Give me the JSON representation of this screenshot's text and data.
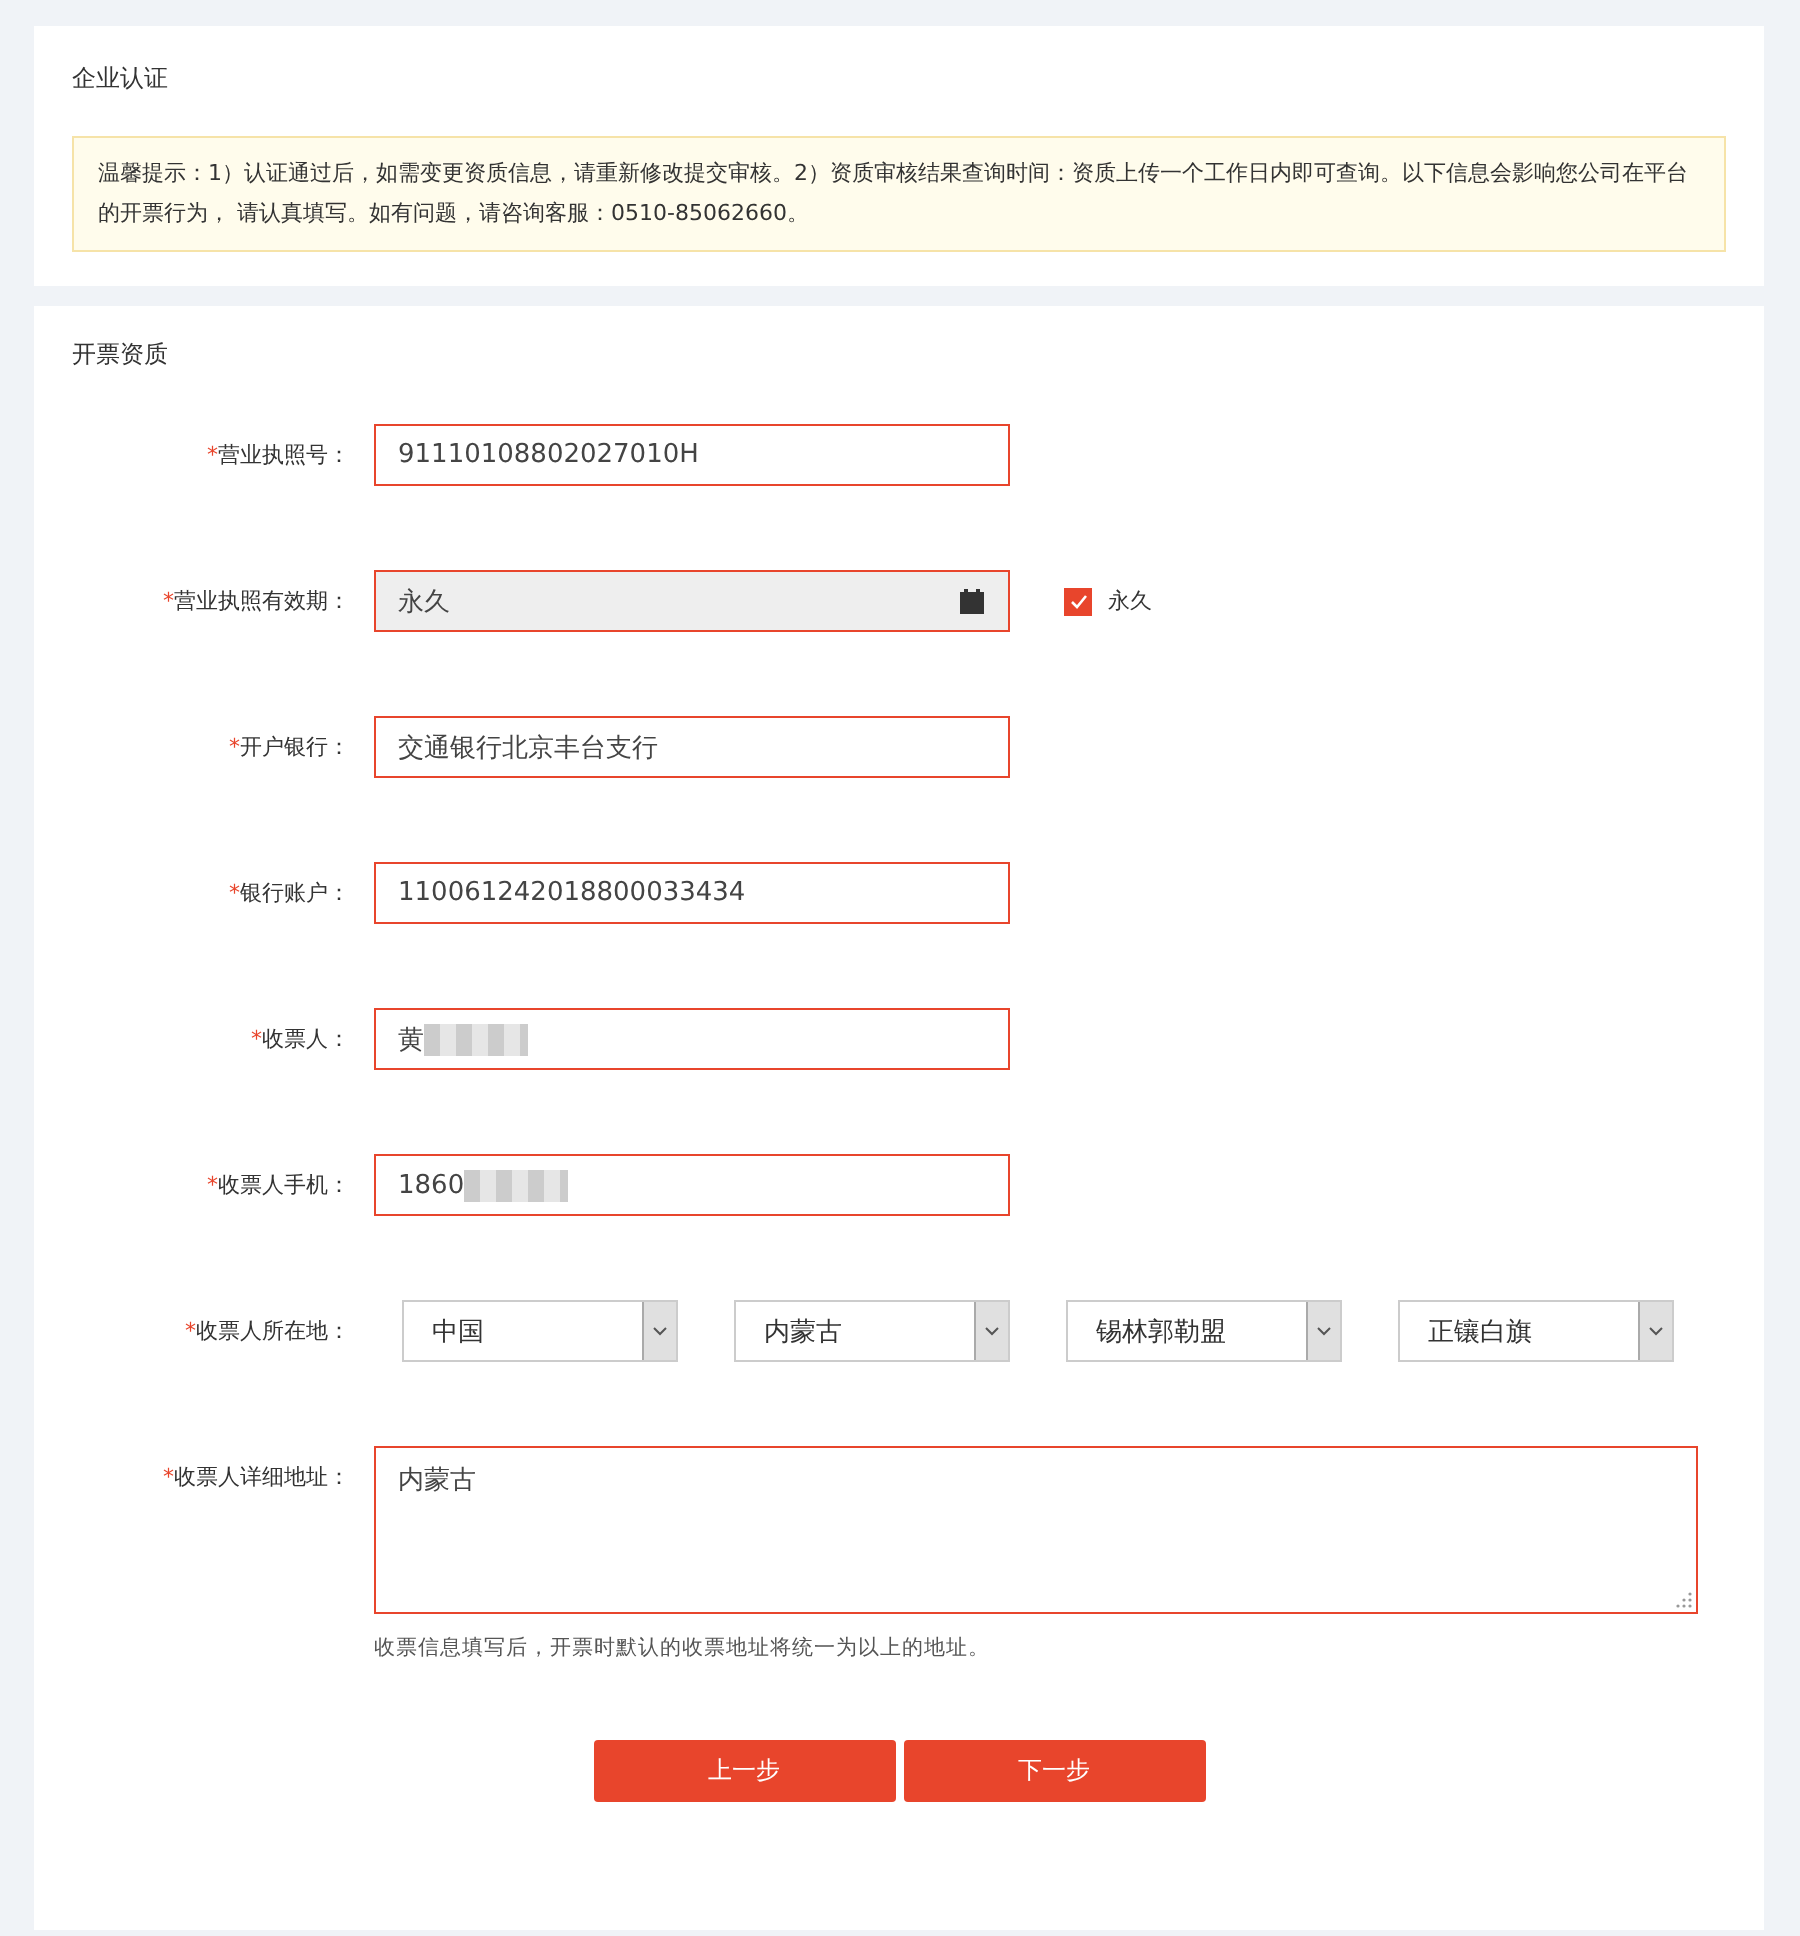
{
  "header": {
    "title": "企业认证",
    "notice": "温馨提示：1）认证通过后，如需变更资质信息，请重新修改提交审核。2）资质审核结果查询时间：资质上传一个工作日内即可查询。以下信息会影响您公司在平台的开票行为， 请认真填写。如有问题，请咨询客服：0510-85062660。"
  },
  "section": {
    "title": "开票资质"
  },
  "fields": [
    {
      "kind": "text",
      "mark": "*",
      "label": "营业执照号：",
      "value": "91110108802027010H",
      "redacted": false
    },
    {
      "kind": "date",
      "mark": "*",
      "label": "营业执照有效期：",
      "value": "永久",
      "disabled": true,
      "checkbox": {
        "label": "永久",
        "checked": true
      }
    },
    {
      "kind": "text",
      "mark": "*",
      "label": "开户银行：",
      "value": "交通银行北京丰台支行",
      "redacted": false
    },
    {
      "kind": "text",
      "mark": "*",
      "label": "银行账户：",
      "value": "110061242018800033434",
      "redacted": false
    },
    {
      "kind": "text",
      "mark": "*",
      "label": "收票人：",
      "value": "黄",
      "redacted": true
    },
    {
      "kind": "text",
      "mark": "*",
      "label": "收票人手机：",
      "value": "1860",
      "redacted": true
    },
    {
      "kind": "select",
      "mark": "*",
      "label": "收票人所在地：",
      "options": [
        {
          "value": "中国"
        },
        {
          "value": "内蒙古"
        },
        {
          "value": "锡林郭勒盟"
        },
        {
          "value": "正镶白旗"
        }
      ]
    },
    {
      "kind": "textarea",
      "mark": "*",
      "label": "收票人详细地址：",
      "value": "内蒙古",
      "hint": "收票信息填写后，开票时默认的收票地址将统一为以上的地址。"
    }
  ],
  "buttons": [
    {
      "label": "上一步"
    },
    {
      "label": "下一步"
    }
  ]
}
